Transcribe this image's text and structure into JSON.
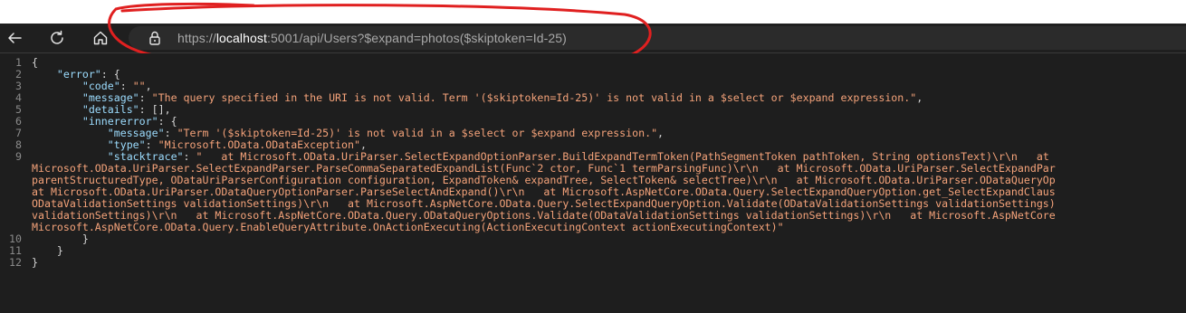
{
  "browser": {
    "url_scheme": "https://",
    "url_host": "localhost",
    "url_rest": ":5001/api/Users?$expand=photos($skiptoken=Id-25)",
    "back_icon": "arrow-left",
    "refresh_icon": "refresh",
    "home_icon": "home",
    "lock_icon": "lock",
    "annotation_color": "#e02020"
  },
  "lines": [
    {
      "n": "1",
      "parts": [
        [
          "p",
          "{"
        ]
      ]
    },
    {
      "n": "2",
      "parts": [
        [
          "p",
          "    "
        ],
        [
          "k",
          "\"error\""
        ],
        [
          "p",
          ": {"
        ]
      ]
    },
    {
      "n": "3",
      "parts": [
        [
          "p",
          "        "
        ],
        [
          "k",
          "\"code\""
        ],
        [
          "p",
          ": "
        ],
        [
          "s",
          "\"\""
        ],
        [
          "p",
          ","
        ]
      ]
    },
    {
      "n": "4",
      "parts": [
        [
          "p",
          "        "
        ],
        [
          "k",
          "\"message\""
        ],
        [
          "p",
          ": "
        ],
        [
          "s",
          "\"The query specified in the URI is not valid. Term '($skiptoken=Id-25)' is not valid in a $select or $expand expression.\""
        ],
        [
          "p",
          ","
        ]
      ]
    },
    {
      "n": "5",
      "parts": [
        [
          "p",
          "        "
        ],
        [
          "k",
          "\"details\""
        ],
        [
          "p",
          ": [],"
        ]
      ]
    },
    {
      "n": "6",
      "parts": [
        [
          "p",
          "        "
        ],
        [
          "k",
          "\"innererror\""
        ],
        [
          "p",
          ": {"
        ]
      ]
    },
    {
      "n": "7",
      "parts": [
        [
          "p",
          "            "
        ],
        [
          "k",
          "\"message\""
        ],
        [
          "p",
          ": "
        ],
        [
          "s",
          "\"Term '($skiptoken=Id-25)' is not valid in a $select or $expand expression.\""
        ],
        [
          "p",
          ","
        ]
      ]
    },
    {
      "n": "8",
      "parts": [
        [
          "p",
          "            "
        ],
        [
          "k",
          "\"type\""
        ],
        [
          "p",
          ": "
        ],
        [
          "s",
          "\"Microsoft.OData.ODataException\""
        ],
        [
          "p",
          ","
        ]
      ]
    },
    {
      "n": "9",
      "parts": [
        [
          "p",
          "            "
        ],
        [
          "k",
          "\"stacktrace\""
        ],
        [
          "p",
          ": "
        ],
        [
          "s",
          "\"   at Microsoft.OData.UriParser.SelectExpandOptionParser.BuildExpandTermToken(PathSegmentToken pathToken, String optionsText)\\r\\n   at"
        ]
      ]
    },
    {
      "n": "",
      "parts": [
        [
          "s",
          "Microsoft.OData.UriParser.SelectExpandParser.ParseCommaSeparatedExpandList(Func`2 ctor, Func`1 termParsingFunc)\\r\\n   at Microsoft.OData.UriParser.SelectExpandPar"
        ]
      ]
    },
    {
      "n": "",
      "parts": [
        [
          "s",
          "parentStructuredType, ODataUriParserConfiguration configuration, ExpandToken& expandTree, SelectToken& selectTree)\\r\\n   at Microsoft.OData.UriParser.ODataQueryOp"
        ]
      ]
    },
    {
      "n": "",
      "parts": [
        [
          "s",
          "at Microsoft.OData.UriParser.ODataQueryOptionParser.ParseSelectAndExpand()\\r\\n   at Microsoft.AspNetCore.OData.Query.SelectExpandQueryOption.get_SelectExpandClaus"
        ]
      ]
    },
    {
      "n": "",
      "parts": [
        [
          "s",
          "ODataValidationSettings validationSettings)\\r\\n   at Microsoft.AspNetCore.OData.Query.SelectExpandQueryOption.Validate(ODataValidationSettings validationSettings)"
        ]
      ]
    },
    {
      "n": "",
      "parts": [
        [
          "s",
          "validationSettings)\\r\\n   at Microsoft.AspNetCore.OData.Query.ODataQueryOptions.Validate(ODataValidationSettings validationSettings)\\r\\n   at Microsoft.AspNetCore"
        ]
      ]
    },
    {
      "n": "",
      "parts": [
        [
          "s",
          "Microsoft.AspNetCore.OData.Query.EnableQueryAttribute.OnActionExecuting(ActionExecutingContext actionExecutingContext)\""
        ]
      ]
    },
    {
      "n": "10",
      "parts": [
        [
          "p",
          "        }"
        ]
      ]
    },
    {
      "n": "11",
      "parts": [
        [
          "p",
          "    }"
        ]
      ]
    },
    {
      "n": "12",
      "parts": [
        [
          "p",
          "}"
        ]
      ]
    }
  ]
}
